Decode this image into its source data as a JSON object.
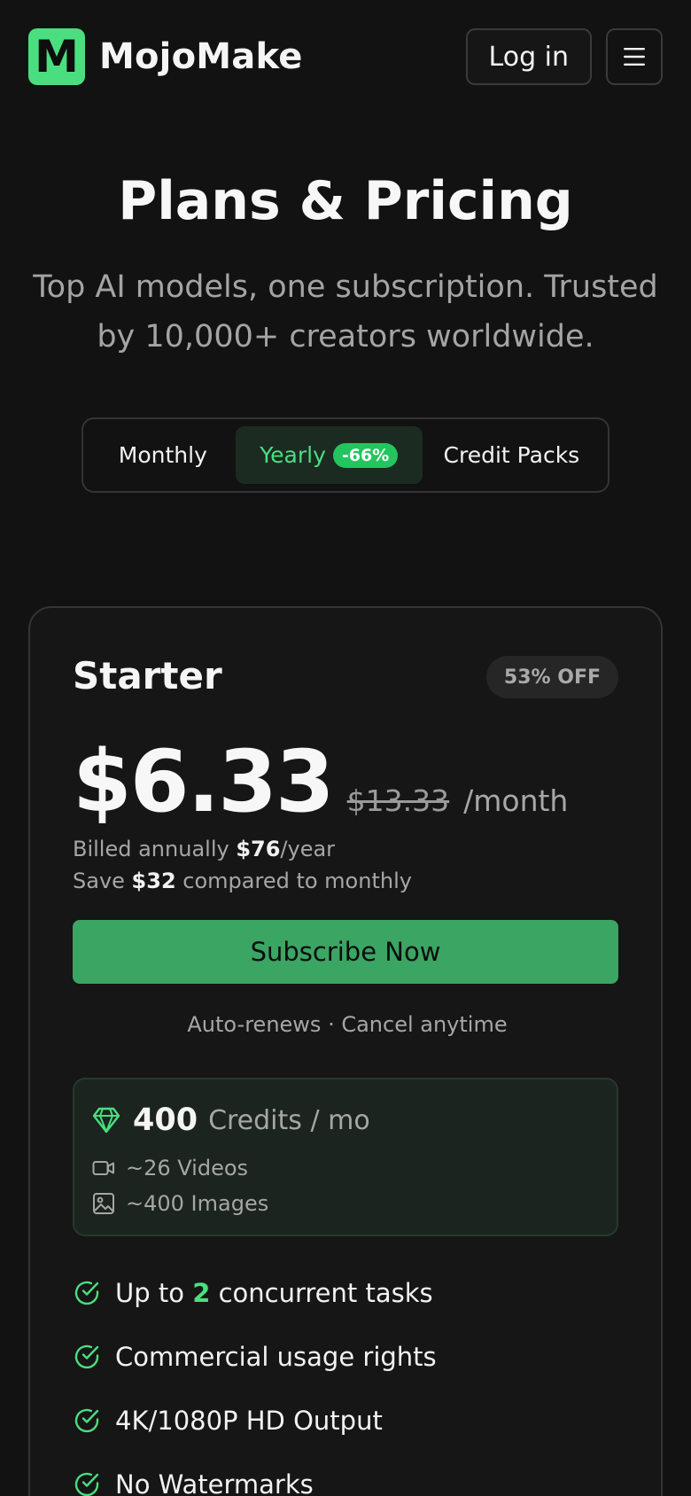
{
  "header": {
    "logo_letter": "M",
    "brand": "MojoMake",
    "login_label": "Log in",
    "menu_icon": "hamburger-menu-icon"
  },
  "hero": {
    "title": "Plans & Pricing",
    "subtitle": "Top AI models, one subscription. Trusted by 10,000+ creators worldwide."
  },
  "billing_toggle": {
    "options": [
      {
        "label": "Monthly",
        "selected": false
      },
      {
        "label": "Yearly",
        "badge": "-66%",
        "selected": true
      },
      {
        "label": "Credit Packs",
        "selected": false
      }
    ]
  },
  "plan": {
    "name": "Starter",
    "discount_badge": "53% OFF",
    "price": "$6.33",
    "original_price": "$13.33",
    "period": "/month",
    "billed_prefix": "Billed annually ",
    "billed_amount": "$76",
    "billed_suffix": "/year",
    "save_prefix": "Save ",
    "save_amount": "$32",
    "save_suffix": " compared to monthly",
    "cta": "Subscribe Now",
    "renew_note": "Auto-renews · Cancel anytime",
    "credits": {
      "amount": "400",
      "unit": "Credits / mo",
      "videos": "~26 Videos",
      "images": "~400 Images"
    },
    "features": [
      {
        "prefix": "Up to ",
        "highlight": "2",
        "suffix": " concurrent tasks"
      },
      {
        "text": "Commercial usage rights"
      },
      {
        "text": "4K/1080P HD Output"
      },
      {
        "text": "No Watermarks"
      }
    ]
  },
  "colors": {
    "accent": "#4ade80",
    "cta": "#3ba564",
    "background": "#121212"
  }
}
